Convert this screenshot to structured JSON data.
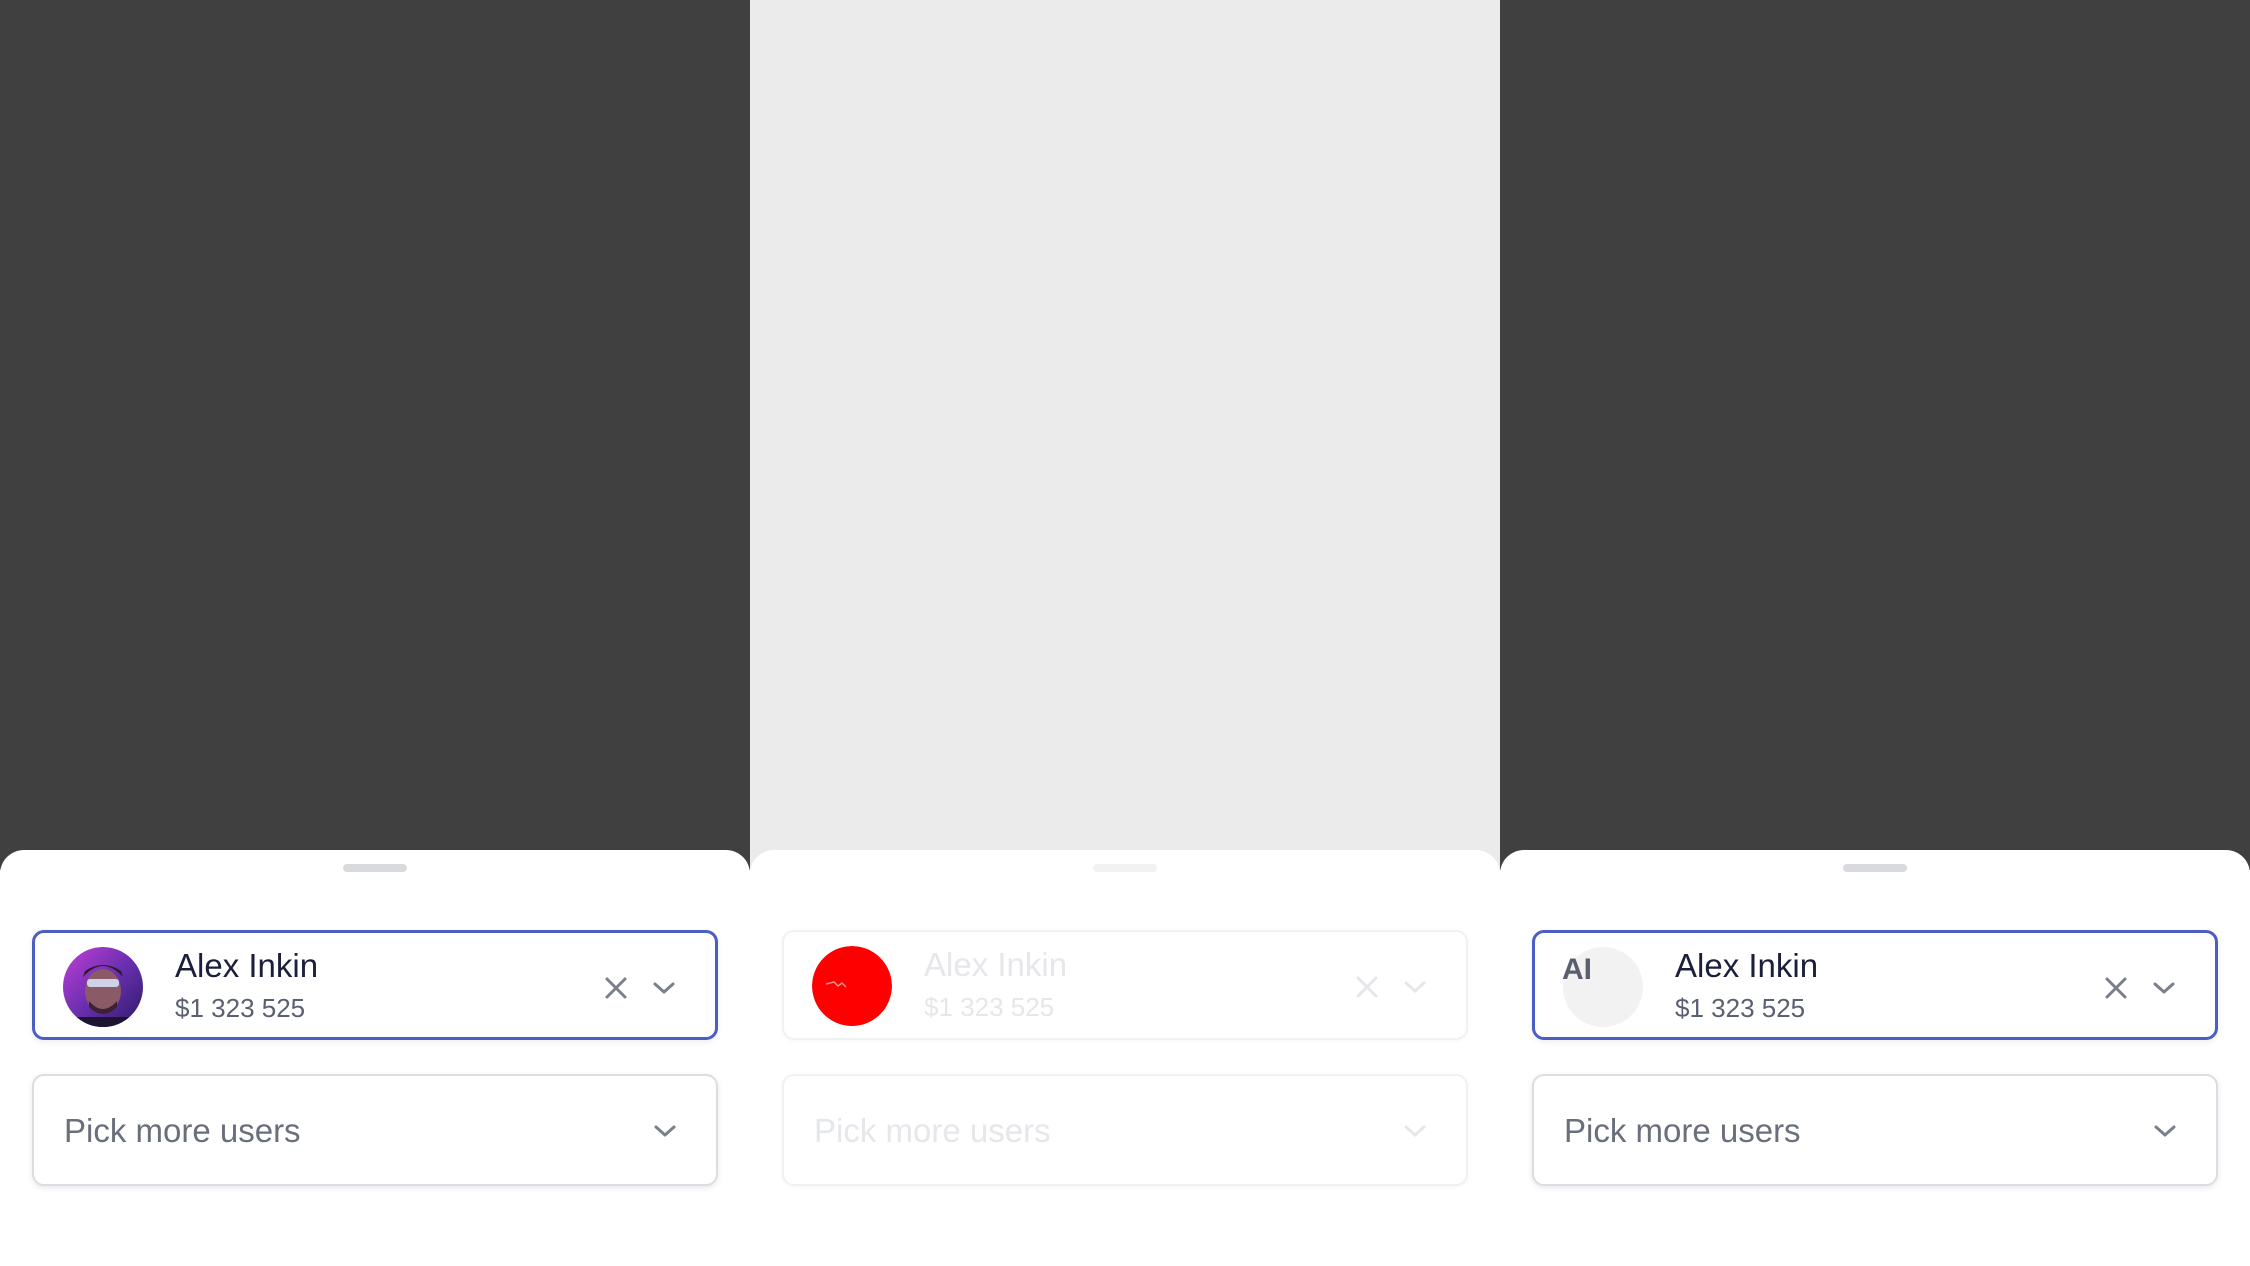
{
  "panels": [
    {
      "state": "focused",
      "avatar_type": "photo",
      "selected_user": {
        "name": "Alex Inkin",
        "amount": "$1 323 525"
      },
      "more_placeholder": "Pick more users"
    },
    {
      "state": "disabled",
      "avatar_type": "photo-broken",
      "selected_user": {
        "name": "Alex Inkin",
        "amount": "$1 323 525"
      },
      "more_placeholder": "Pick more users"
    },
    {
      "state": "focused",
      "avatar_type": "initials",
      "avatar_initials": "AI",
      "selected_user": {
        "name": "Alex Inkin",
        "amount": "$1 323 525"
      },
      "more_placeholder": "Pick more users"
    }
  ],
  "icons": [
    "close-icon",
    "chevron-down-icon"
  ],
  "colors": {
    "backdrop_dark": "#404040",
    "backdrop_light": "#ebebeb",
    "focus_border": "#4a5ec4",
    "avatar_broken": "#ff0000"
  }
}
